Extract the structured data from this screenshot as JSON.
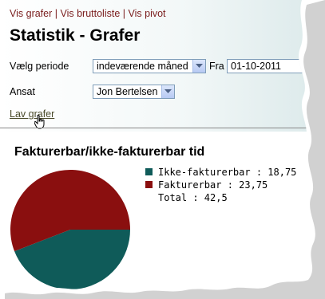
{
  "nav": {
    "links": [
      "Vis grafer",
      "Vis bruttoliste",
      "Vis pivot"
    ],
    "separator": "|"
  },
  "page": {
    "title": "Statistik - Grafer"
  },
  "form": {
    "period_label": "Vælg periode",
    "period_value": "indeværende måned",
    "from_label": "Fra",
    "from_value": "01-10-2011",
    "employee_label": "Ansat",
    "employee_value": "Jon Bertelsen",
    "submit_link": "Lav grafer"
  },
  "chart_data": {
    "type": "pie",
    "title": "Fakturerbar/ikke-fakturerbar tid",
    "slices": [
      {
        "label": "Ikke-fakturerbar",
        "value": 18.75,
        "color": "#0f5b59"
      },
      {
        "label": "Fakturerbar",
        "value": 23.75,
        "color": "#8a0f0f"
      }
    ],
    "total_label": "Total",
    "total_value": 42.5,
    "legend_items": [
      {
        "text": "Ikke-fakturerbar : 18,75",
        "color": "#0f5b59"
      },
      {
        "text": "Fakturerbar : 23,75",
        "color": "#8a0f0f"
      },
      {
        "text": "Total : 42,5"
      }
    ]
  },
  "colors": {
    "link": "#7a1d1d",
    "pie_teal": "#0f5b59",
    "pie_red": "#8a0f0f"
  }
}
